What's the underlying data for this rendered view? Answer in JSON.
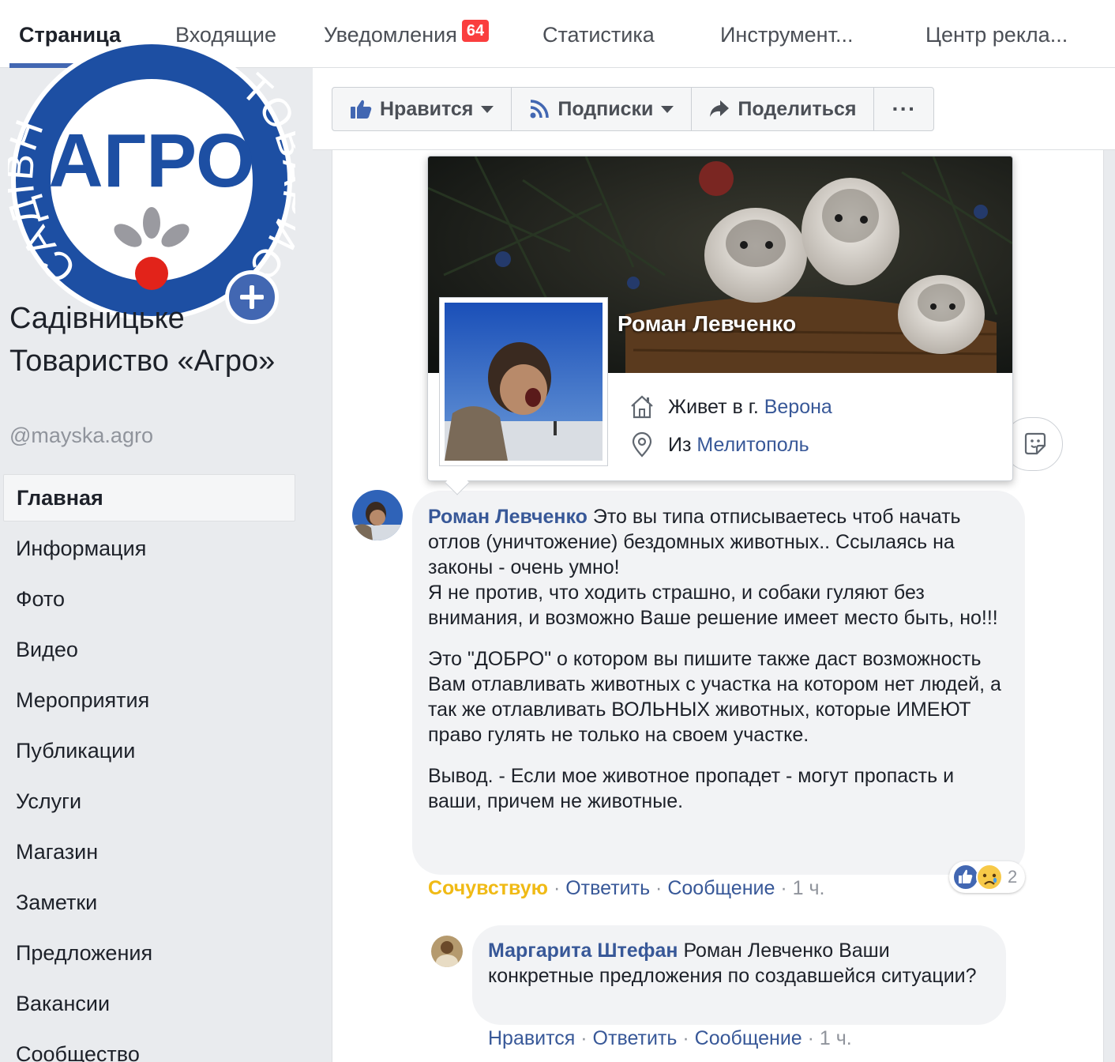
{
  "tabs": [
    {
      "label": "Страница"
    },
    {
      "label": "Входящие"
    },
    {
      "label": "Уведомления",
      "badge": "64"
    },
    {
      "label": "Статистика"
    },
    {
      "label": "Инструмент..."
    },
    {
      "label": "Центр рекла..."
    }
  ],
  "page": {
    "logo_text": "АГРО",
    "logo_ring_left": "САДІВН",
    "logo_ring_right": "ТОВАРИСТВО",
    "name": "Садівницьке Товариство «Агро»",
    "handle": "@mayska.agro"
  },
  "nav": {
    "items": [
      {
        "label": "Главная"
      },
      {
        "label": "Информация"
      },
      {
        "label": "Фото"
      },
      {
        "label": "Видео"
      },
      {
        "label": "Мероприятия"
      },
      {
        "label": "Публикации"
      },
      {
        "label": "Услуги"
      },
      {
        "label": "Магазин"
      },
      {
        "label": "Заметки"
      },
      {
        "label": "Предложения"
      },
      {
        "label": "Вакансии"
      },
      {
        "label": "Сообщество"
      }
    ]
  },
  "actionbar": {
    "like": "Нравится",
    "follow": "Подписки",
    "share": "Поделиться",
    "more": "···"
  },
  "hovercard": {
    "name": "Роман Левченко",
    "lives_prefix": "Живет в г.",
    "lives_city": "Верона",
    "from_prefix": "Из",
    "from_city": "Мелитополь"
  },
  "comment1": {
    "author": "Роман Левченко",
    "p1": "Это вы типа отписываетесь чтоб начать отлов (уничтожение) бездомных животных.. Ссылаясь на законы - очень умно!",
    "p1b": "Я не против, что ходить страшно, и собаки гуляют без внимания, и возможно Ваше решение имеет место быть, но!!!",
    "p2": "Это \"ДОБРО\" о котором вы пишите также даст возможность Вам отлавливать животных с участка на котором нет людей, а так же отлавливать ВОЛЬНЫХ животных, которые ИМЕЮТ право гулять не только на своем участке.",
    "p3": "Вывод. - Если мое животное пропадет - могут пропасть и ваши, причем не животные.",
    "reaction_label": "Сочувствую",
    "reply": "Ответить",
    "message": "Сообщение",
    "time": "1 ч.",
    "reactions_count": "2"
  },
  "comment2": {
    "author": "Маргарита Штефан",
    "text": "Роман Левченко Ваши конкретные предложения по создавшейся ситуации?",
    "like": "Нравится",
    "reply": "Ответить",
    "message": "Сообщение",
    "time": "1 ч."
  },
  "colors": {
    "brand_blue": "#4267b2",
    "link": "#385898",
    "sympathy": "#f0ba15",
    "badge": "#fa3e3e",
    "logo_blue": "#1d4fa3",
    "logo_red": "#e2231a"
  }
}
